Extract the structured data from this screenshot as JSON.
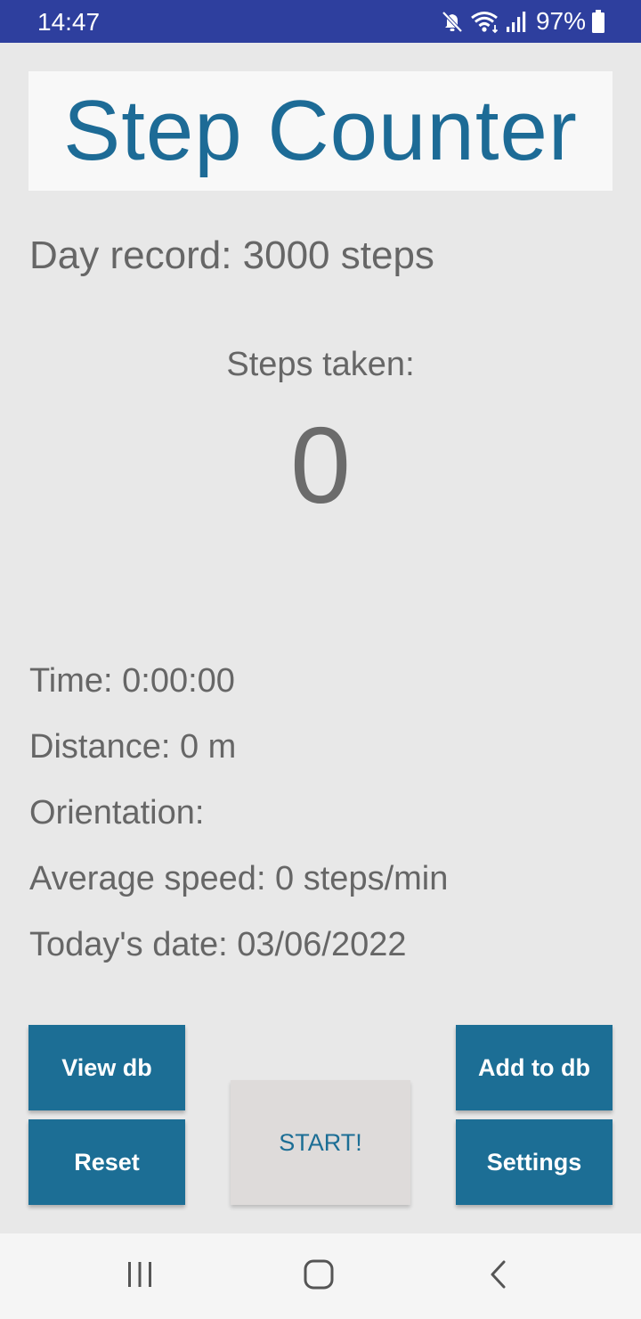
{
  "status_bar": {
    "time": "14:47",
    "battery": "97%",
    "icons": [
      "mute-icon",
      "wifi-icon",
      "signal-icon",
      "battery-icon"
    ]
  },
  "app": {
    "title": "Step Counter",
    "day_record": "Day record: 3000 steps",
    "steps_label": "Steps taken:",
    "steps_count": "0"
  },
  "info": {
    "time": "Time: 0:00:00",
    "distance": "Distance: 0 m",
    "orientation": "Orientation:",
    "average_speed": "Average speed: 0 steps/min",
    "date": "Today's date: 03/06/2022"
  },
  "buttons": {
    "view_db": "View db",
    "add_to_db": "Add to db",
    "reset": "Reset",
    "settings": "Settings",
    "start": "START!"
  },
  "nav_bar": {
    "icons": [
      "recent-apps-icon",
      "home-icon",
      "back-icon"
    ]
  },
  "colors": {
    "status_bar": "#2e3f9e",
    "accent": "#1c6e95",
    "background": "#e8e8e8",
    "text": "#666666"
  }
}
